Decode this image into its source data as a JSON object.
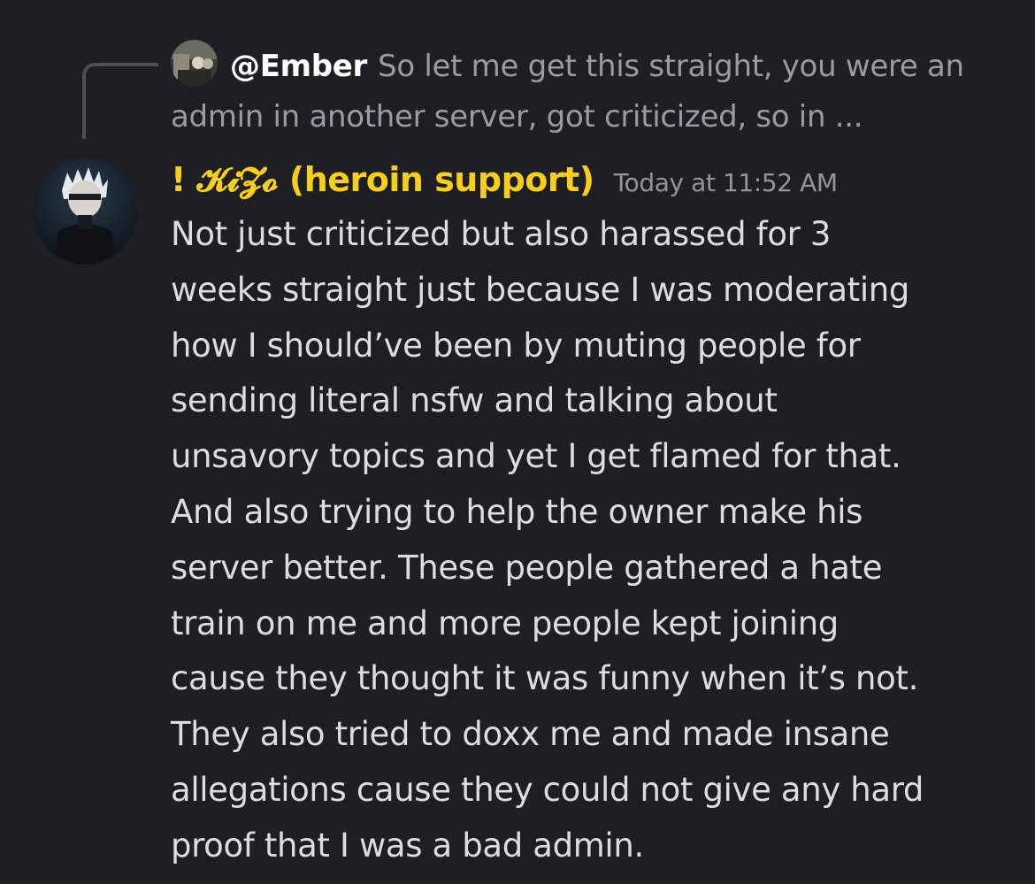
{
  "reply": {
    "author": "@Ember",
    "text": "So let me get this straight, you were an admin in another server, got criticized, so in ..."
  },
  "message": {
    "username": "! 𝓚𝓲𝓩𝓸 (heroin support)",
    "timestamp": "Today at 11:52 AM",
    "lines": [
      "Not just criticized but also harassed for 3",
      "weeks straight just because I was moderating",
      "how I should’ve been by muting people for",
      "sending literal nsfw and talking about",
      "unsavory topics and yet I get flamed for that.",
      "And also trying to help the owner make his",
      "server better. These people gathered a hate",
      "train on me and more people kept joining",
      "cause they thought it was funny when it’s not.",
      "They also tried to doxx me and made insane",
      "allegations cause they could not give any hard",
      "proof that I was a bad admin."
    ]
  },
  "colors": {
    "background": "#1e1f24",
    "username": "#f7cf1b",
    "reply_text": "#9a9ca3",
    "message_text": "#dbdee1",
    "timestamp": "#94969c"
  },
  "icons": {
    "reply_avatar": "user-avatar-icon",
    "author_avatar": "anime-character-avatar-icon"
  }
}
